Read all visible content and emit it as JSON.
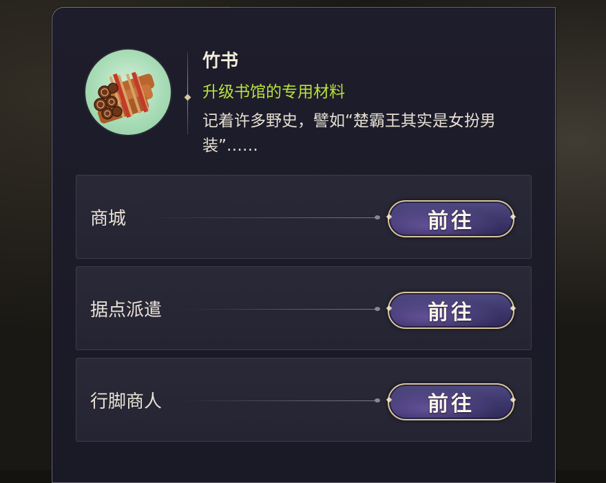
{
  "item": {
    "name": "竹书",
    "usage": "升级书馆的专用材料",
    "description": "记着许多野史，譬如“楚霸王其实是女扮男装”……",
    "icon": "bamboo-scroll-bundle-icon"
  },
  "sources": [
    {
      "label": "商城",
      "button": "前往"
    },
    {
      "label": "据点派遣",
      "button": "前往"
    },
    {
      "label": "行脚商人",
      "button": "前往"
    }
  ],
  "colors": {
    "panel_bg": "#1e1d2b",
    "usage_text": "#b9e23c",
    "button_border": "#d9c79a",
    "button_fill": "#3d376b"
  }
}
